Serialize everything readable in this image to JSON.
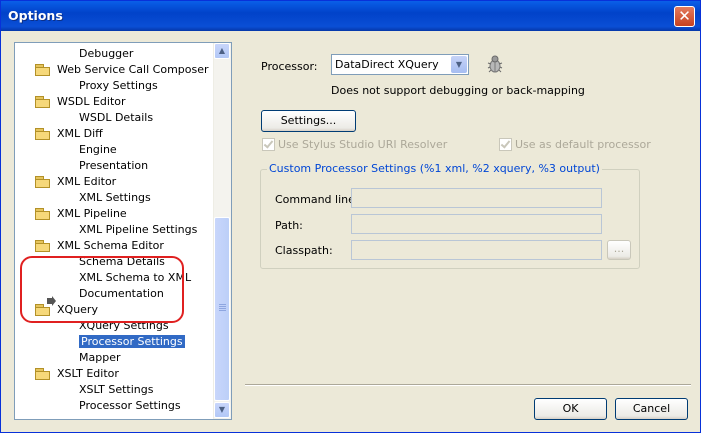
{
  "window": {
    "title": "Options",
    "close_glyph": "✕"
  },
  "tree": {
    "items": [
      {
        "label": "Debugger",
        "level": 1,
        "folder": false
      },
      {
        "label": "Web Service Call Composer",
        "level": 0,
        "folder": true
      },
      {
        "label": "Proxy Settings",
        "level": 1,
        "folder": false
      },
      {
        "label": "WSDL Editor",
        "level": 0,
        "folder": true
      },
      {
        "label": "WSDL Details",
        "level": 1,
        "folder": false
      },
      {
        "label": "XML Diff",
        "level": 0,
        "folder": true
      },
      {
        "label": "Engine",
        "level": 1,
        "folder": false
      },
      {
        "label": "Presentation",
        "level": 1,
        "folder": false
      },
      {
        "label": "XML Editor",
        "level": 0,
        "folder": true
      },
      {
        "label": "XML Settings",
        "level": 1,
        "folder": false
      },
      {
        "label": "XML Pipeline",
        "level": 0,
        "folder": true
      },
      {
        "label": "XML Pipeline Settings",
        "level": 1,
        "folder": false
      },
      {
        "label": "XML Schema Editor",
        "level": 0,
        "folder": true
      },
      {
        "label": "Schema Details",
        "level": 1,
        "folder": false
      },
      {
        "label": "XML Schema to XML",
        "level": 1,
        "folder": false
      },
      {
        "label": "Documentation",
        "level": 1,
        "folder": false
      },
      {
        "label": "XQuery",
        "level": 0,
        "folder": true
      },
      {
        "label": "XQuery Settings",
        "level": 1,
        "folder": false
      },
      {
        "label": "Processor Settings",
        "level": 1,
        "folder": false,
        "selected": true
      },
      {
        "label": "Mapper",
        "level": 1,
        "folder": false
      },
      {
        "label": "XSLT Editor",
        "level": 0,
        "folder": true
      },
      {
        "label": "XSLT Settings",
        "level": 1,
        "folder": false
      },
      {
        "label": "Processor Settings",
        "level": 1,
        "folder": false
      }
    ]
  },
  "processor": {
    "label": "Processor:",
    "value": "DataDirect XQuery",
    "note": "Does not support debugging or back-mapping",
    "settings_button": "Settings...",
    "use_stylus_uri_resolver": "Use Stylus Studio URI Resolver",
    "use_as_default": "Use as default processor"
  },
  "custom": {
    "legend": "Custom Processor Settings (%1 xml, %2 xquery, %3 output)",
    "command_line_label": "Command line:",
    "path_label": "Path:",
    "classpath_label": "Classpath:",
    "browse_label": "..."
  },
  "footer": {
    "ok": "OK",
    "cancel": "Cancel"
  },
  "colors": {
    "titlebar": "#0142c9",
    "selection": "#316ac5",
    "group_legend": "#0046d5",
    "highlight": "#e02020"
  }
}
